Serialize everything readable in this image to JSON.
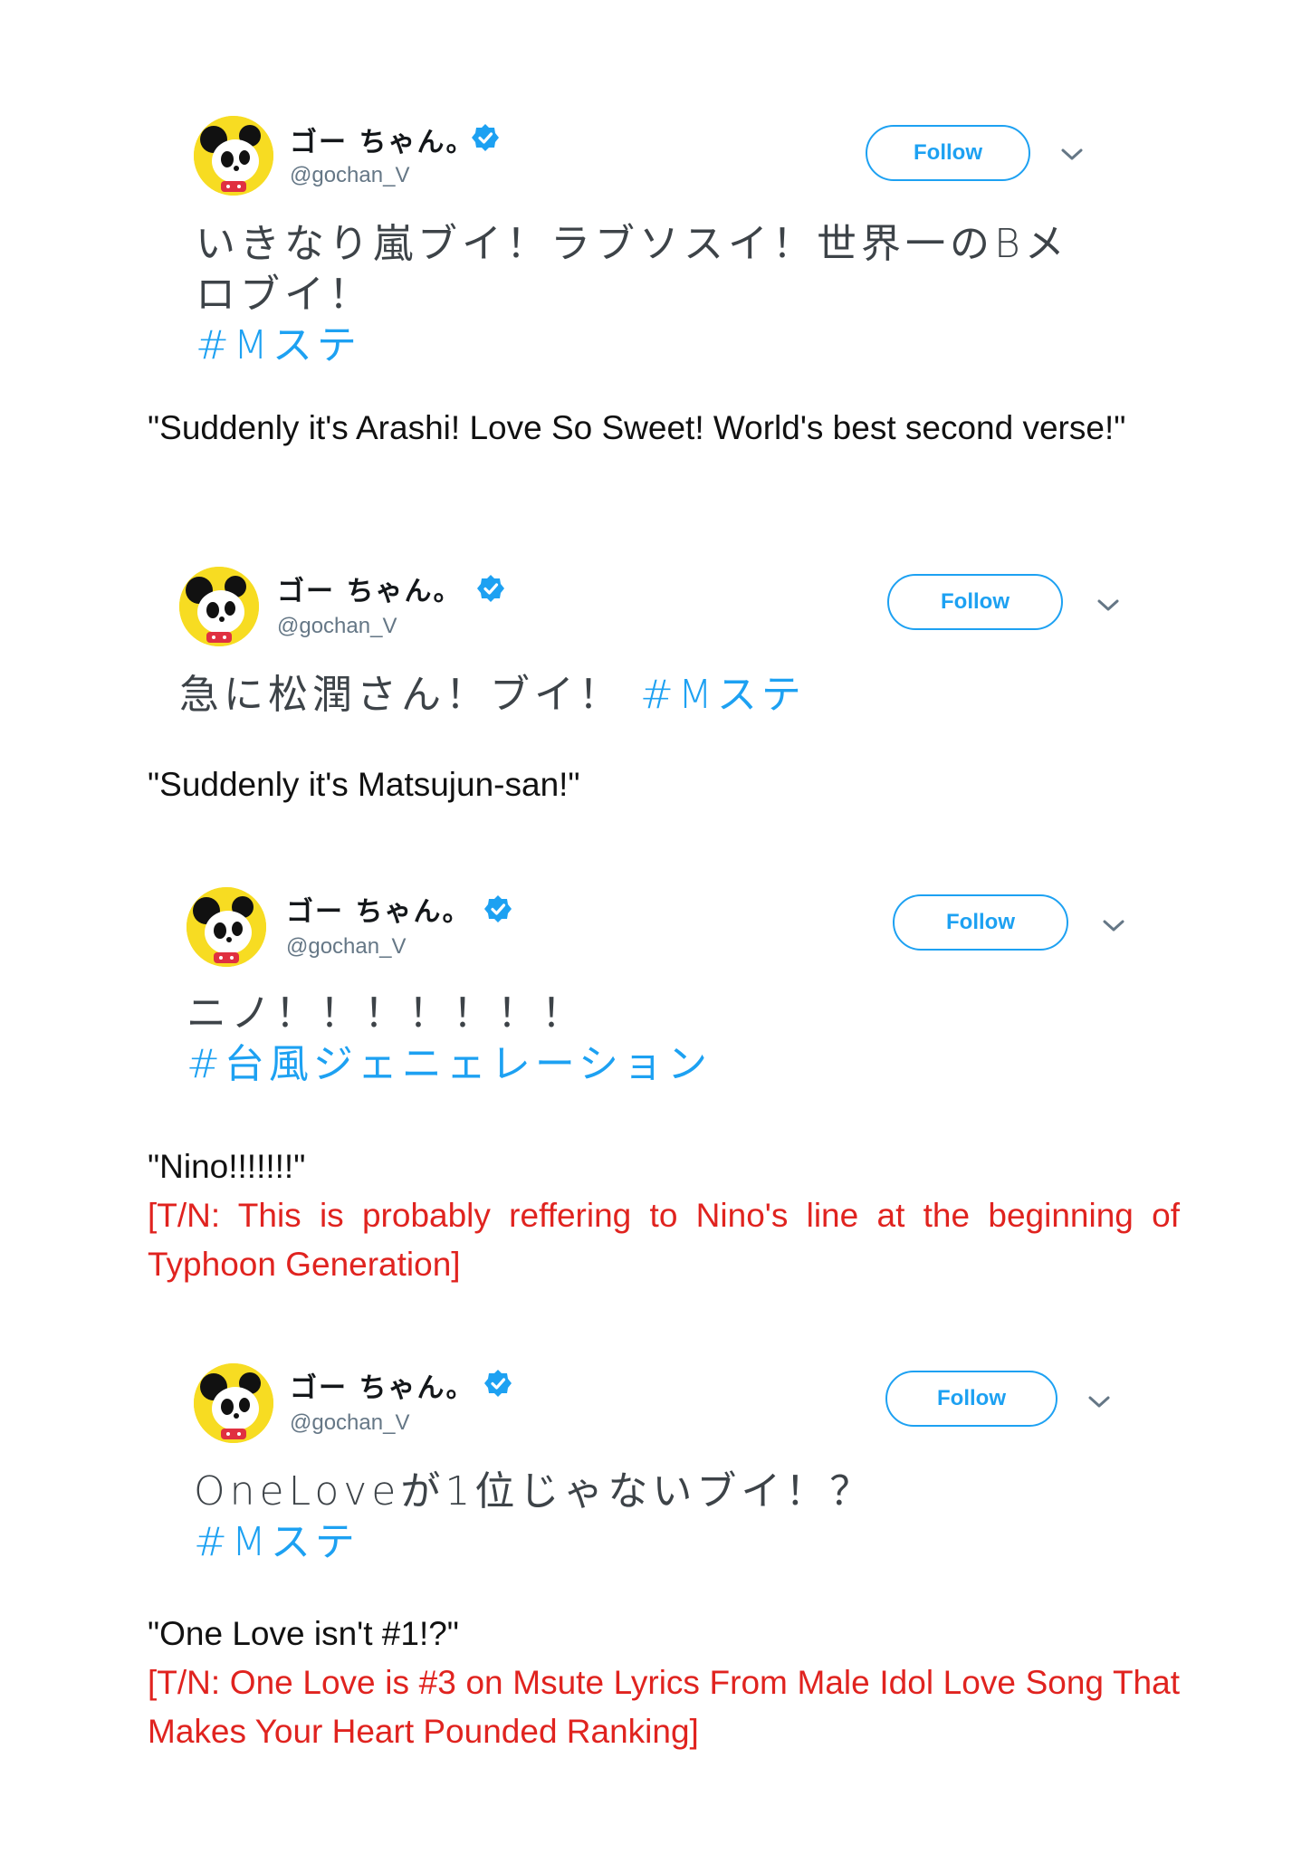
{
  "colors": {
    "accent": "#1da1f2",
    "translator_note": "#e0231f",
    "text": "#111111"
  },
  "tweets": [
    {
      "display_name": "ゴー ちゃん。",
      "handle": "@gochan_V",
      "follow_label": "Follow",
      "text_lines": [
        "いきなり嵐ブイ！ラブソスイ！世界一のBメ",
        "ロブイ！"
      ],
      "hashtag": "#Mステ",
      "caption": "\"Suddenly it's Arashi! Love So Sweet! World's best second verse!\"",
      "translator_note": ""
    },
    {
      "display_name": "ゴー ちゃん。",
      "handle": "@gochan_V",
      "follow_label": "Follow",
      "text_lines": [
        "急に松潤さん！ブイ！ "
      ],
      "hashtag": "#Mステ",
      "caption": "\"Suddenly it's Matsujun-san!\"",
      "translator_note": ""
    },
    {
      "display_name": "ゴー ちゃん。",
      "handle": "@gochan_V",
      "follow_label": "Follow",
      "text_lines": [
        "ニノ！！！！！！！"
      ],
      "hashtag": "#台風ジェニェレーション",
      "caption": "\"Nino!!!!!!!\"",
      "translator_note": "[T/N: This is probably reffering to Nino's line at the beginning of Typhoon Generation]"
    },
    {
      "display_name": "ゴー ちゃん。",
      "handle": "@gochan_V",
      "follow_label": "Follow",
      "text_lines": [
        "OneLoveが1位じゃないブイ！？"
      ],
      "hashtag": "#Mステ",
      "caption": "\"One Love isn't #1!?\"",
      "translator_note": "[T/N: One Love is #3 on Msute Lyrics From Male Idol Love Song That Makes Your Heart Pounded Ranking]"
    }
  ]
}
